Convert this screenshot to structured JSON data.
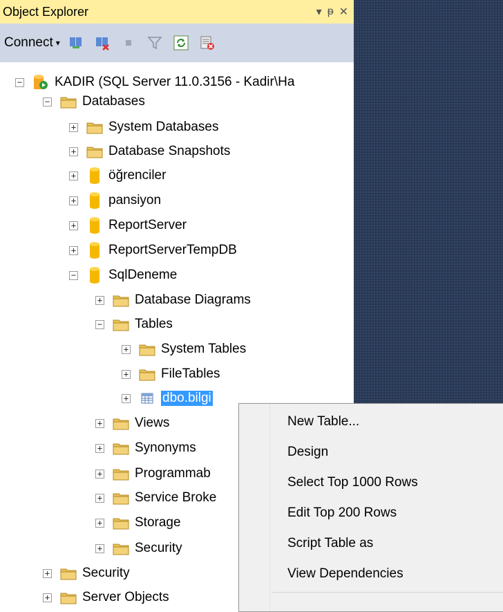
{
  "panel": {
    "title": "Object Explorer",
    "controls": {
      "dropdown": "▾",
      "pin": "ᵽ",
      "close": "✕"
    }
  },
  "toolbar": {
    "connect_label": "Connect",
    "connect_arrow": "▾",
    "icons": [
      "connect-object-explorer-icon",
      "disconnect-icon",
      "stop-icon",
      "filter-icon",
      "refresh-icon",
      "activity-monitor-icon"
    ]
  },
  "tree": [
    {
      "id": "server",
      "label": "KADIR (SQL Server 11.0.3156 - Kadir\\Ha",
      "expander": "−",
      "icon": "server-icon"
    },
    {
      "id": "databases",
      "label": "Databases",
      "expander": "−",
      "icon": "folder-icon"
    },
    {
      "id": "system-databases",
      "label": "System Databases",
      "expander": "+",
      "icon": "folder-icon"
    },
    {
      "id": "database-snapshots",
      "label": "Database Snapshots",
      "expander": "+",
      "icon": "folder-icon"
    },
    {
      "id": "ogrenciler",
      "label": "öğrenciler",
      "expander": "+",
      "icon": "database-icon"
    },
    {
      "id": "pansiyon",
      "label": "pansiyon",
      "expander": "+",
      "icon": "database-icon"
    },
    {
      "id": "reportserver",
      "label": "ReportServer",
      "expander": "+",
      "icon": "database-icon"
    },
    {
      "id": "reportservertempdb",
      "label": "ReportServerTempDB",
      "expander": "+",
      "icon": "database-icon"
    },
    {
      "id": "sqldeneme",
      "label": "SqlDeneme",
      "expander": "−",
      "icon": "database-icon"
    },
    {
      "id": "database-diagrams",
      "label": "Database Diagrams",
      "expander": "+",
      "icon": "folder-icon"
    },
    {
      "id": "tables",
      "label": "Tables",
      "expander": "−",
      "icon": "folder-icon"
    },
    {
      "id": "system-tables",
      "label": "System Tables",
      "expander": "+",
      "icon": "folder-icon"
    },
    {
      "id": "filetables",
      "label": "FileTables",
      "expander": "+",
      "icon": "folder-icon"
    },
    {
      "id": "dbo-bilgi",
      "label": "dbo.bilgi",
      "expander": "+",
      "icon": "table-icon",
      "selected": true
    },
    {
      "id": "views",
      "label": "Views",
      "expander": "+",
      "icon": "folder-icon"
    },
    {
      "id": "synonyms",
      "label": "Synonyms",
      "expander": "+",
      "icon": "folder-icon"
    },
    {
      "id": "programmability",
      "label": "Programmab",
      "expander": "+",
      "icon": "folder-icon"
    },
    {
      "id": "service-broker",
      "label": "Service Broke",
      "expander": "+",
      "icon": "folder-icon"
    },
    {
      "id": "storage",
      "label": "Storage",
      "expander": "+",
      "icon": "folder-icon"
    },
    {
      "id": "db-security",
      "label": "Security",
      "expander": "+",
      "icon": "folder-icon"
    },
    {
      "id": "security",
      "label": "Security",
      "expander": "+",
      "icon": "folder-icon"
    },
    {
      "id": "server-objects",
      "label": "Server Objects",
      "expander": "+",
      "icon": "folder-icon"
    }
  ],
  "context_menu": {
    "items": [
      {
        "id": "new-table",
        "label": "New Table..."
      },
      {
        "id": "design",
        "label": "Design"
      },
      {
        "id": "select-top-1000",
        "label": "Select Top 1000 Rows"
      },
      {
        "id": "edit-top-200",
        "label": "Edit Top 200 Rows"
      },
      {
        "id": "script-table-as",
        "label": "Script Table as",
        "submenu": "▶"
      },
      {
        "id": "view-dependencies",
        "label": "View Dependencies"
      }
    ]
  },
  "colors": {
    "title_bar": "#ffef9f",
    "toolbar": "#cfd6e5",
    "mdi_background": "#293955",
    "selection": "#3399ff",
    "folder": "#e8c15a",
    "database": "#f5b800"
  }
}
